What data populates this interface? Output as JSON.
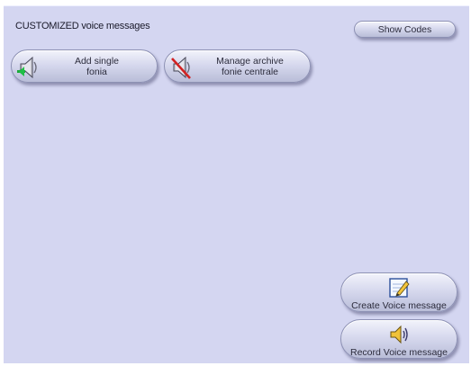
{
  "header": {
    "title": "CUSTOMIZED voice messages",
    "show_codes_label": "Show Codes"
  },
  "actions": {
    "add_single": {
      "label": "Add single\nfonia",
      "icon": "speaker-plus-icon"
    },
    "manage_archive": {
      "label": "Manage archive\nfonie centrale",
      "icon": "speaker-mute-icon"
    }
  },
  "bottom_actions": {
    "create": {
      "label": "Create Voice message",
      "icon": "notepad-pencil-icon"
    },
    "record": {
      "label": "Record Voice message",
      "icon": "speaker-sound-icon"
    }
  },
  "colors": {
    "panel_background": "#d4d6f1",
    "button_border": "#8d91b4"
  }
}
